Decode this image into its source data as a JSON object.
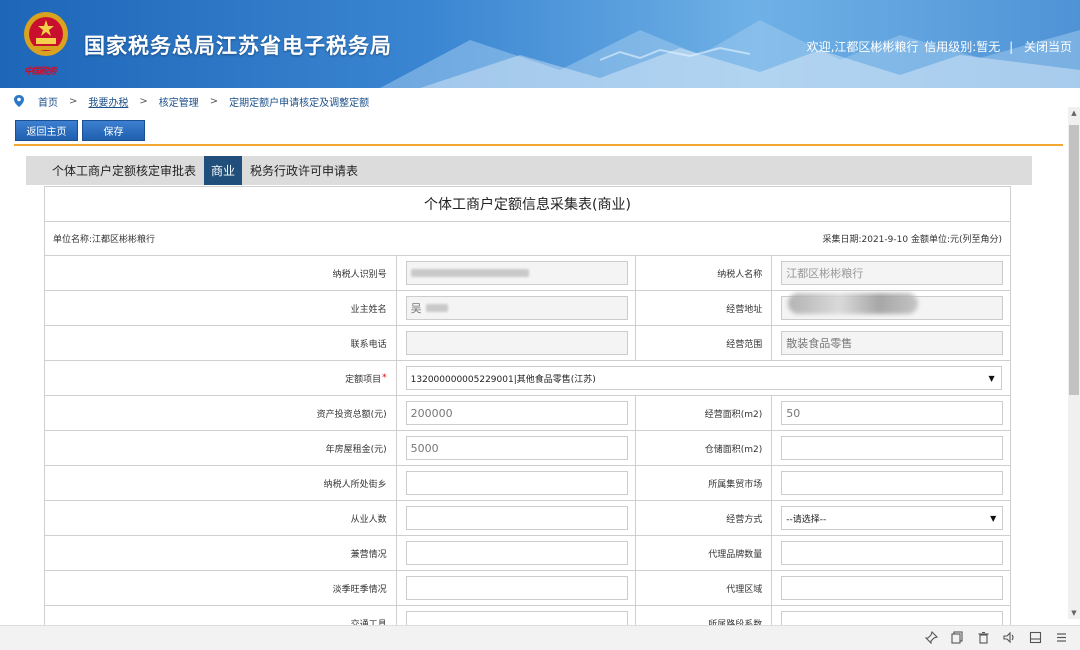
{
  "header": {
    "site_title": "国家税务总局江苏省电子税务局",
    "emblem_caption": "中国税务",
    "welcome": "欢迎,江都区彬彬粮行",
    "credit": "信用级别:暂无",
    "sep": "|",
    "close_page": "关闭当页"
  },
  "breadcrumb": {
    "home": "首页",
    "sep": ">",
    "do_tax": "我要办税",
    "verify": "核定管理",
    "current": "定期定额户申请核定及调整定额"
  },
  "toolbar": {
    "back": "返回主页",
    "save": "保存"
  },
  "tabs": [
    {
      "label": "个体工商户定额核定审批表"
    },
    {
      "label": "商业"
    },
    {
      "label": "税务行政许可申请表"
    }
  ],
  "form": {
    "title": "个体工商户定额信息采集表(商业)",
    "unit_name": "单位名称:江都区彬彬粮行",
    "collect_info": "采集日期:2021-9-10 金额单位:元(列至角分)",
    "fields": {
      "taxpayer_id_label": "纳税人识别号",
      "taxpayer_id_value": "9132xxxxxxxxxxxx",
      "taxpayer_name_label": "纳税人名称",
      "taxpayer_name_value": "江都区彬彬粮行",
      "owner_label": "业主姓名",
      "owner_value": "吴",
      "address_label": "经营地址",
      "phone_label": "联系电话",
      "scope_label": "经营范围",
      "scope_value": "散装食品零售",
      "project_label": "定额项目",
      "project_required": "*",
      "project_value": "132000000005229001|其他食品零售(江苏)",
      "assets_label": "资产投资总额(元)",
      "assets_value": "200000",
      "area_label": "经营面积(m2)",
      "area_value": "50",
      "rent_label": "年房屋租金(元)",
      "rent_value": "5000",
      "warehouse_label": "仓储面积(m2)",
      "street_label": "纳税人所处街乡",
      "market_label": "所属集贸市场",
      "staff_label": "从业人数",
      "mode_label": "经营方式",
      "mode_value": "--请选择--",
      "side_label": "兼营情况",
      "agent_brand_label": "代理品牌数量",
      "season_label": "淡季旺季情况",
      "agent_area_label": "代理区域",
      "vehicle_label": "交通工具",
      "road_label": "所属路段系数"
    }
  }
}
